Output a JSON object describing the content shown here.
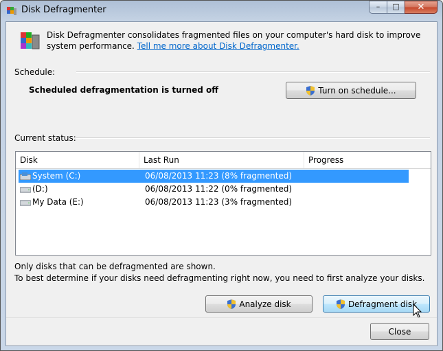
{
  "window": {
    "title": "Disk Defragmenter"
  },
  "controls": {
    "minimize": "–",
    "maximize": "□",
    "close": "✕"
  },
  "intro": {
    "text": "Disk Defragmenter consolidates fragmented files on your computer's hard disk to improve system performance. ",
    "link": "Tell me more about Disk Defragmenter."
  },
  "schedule": {
    "label": "Schedule:",
    "status": "Scheduled defragmentation is turned off",
    "button": "Turn on schedule..."
  },
  "status": {
    "label": "Current status:",
    "columns": [
      "Disk",
      "Last Run",
      "Progress"
    ],
    "rows": [
      {
        "disk": "System (C:)",
        "last_run": "06/08/2013 11:23 (8% fragmented)",
        "progress": "",
        "icon": "system-drive-icon",
        "selected": true
      },
      {
        "disk": "(D:)",
        "last_run": "06/08/2013 11:22 (0% fragmented)",
        "progress": "",
        "icon": "drive-icon",
        "selected": false
      },
      {
        "disk": "My Data (E:)",
        "last_run": "06/08/2013 11:23 (3% fragmented)",
        "progress": "",
        "icon": "drive-icon",
        "selected": false
      }
    ]
  },
  "notes": {
    "line1": "Only disks that can be defragmented are shown.",
    "line2": "To best determine if your disks need defragmenting right now, you need to first analyze your disks."
  },
  "actions": {
    "analyze": "Analyze disk",
    "defragment": "Defragment disk",
    "close": "Close"
  },
  "colors": {
    "selection": "#3399ff",
    "link": "#0066cc"
  }
}
